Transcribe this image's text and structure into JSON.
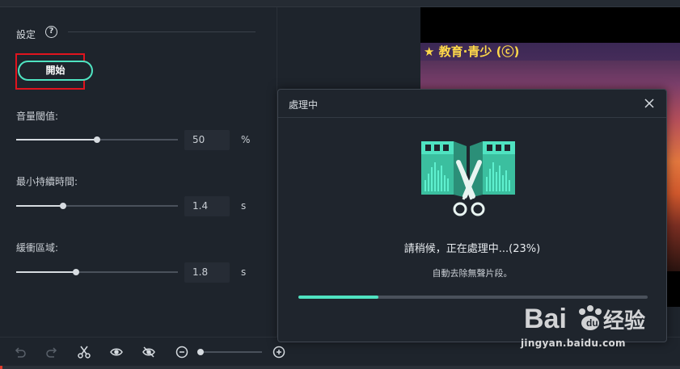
{
  "settings": {
    "title": "設定",
    "help_glyph": "?",
    "start_label": "開始"
  },
  "fields": [
    {
      "label": "音量閾值:",
      "value": "50",
      "unit": "%",
      "fraction": 0.5
    },
    {
      "label": "最小持續時間:",
      "value": "1.4",
      "unit": "s",
      "fraction": 0.29
    },
    {
      "label": "緩衝區域:",
      "value": "1.8",
      "unit": "s",
      "fraction": 0.37
    }
  ],
  "preview": {
    "caption": "★ 教育·青少 (ⓒ)"
  },
  "dialog": {
    "title": "處理中",
    "status": "請稍候，正在處理中...(23%)",
    "subtitle": "自動去除無聲片段。",
    "progress": 0.23
  },
  "toolbar": {
    "zoom_level": 0.05,
    "icons": [
      "undo-icon",
      "redo-icon",
      "scissors-icon",
      "eye-icon",
      "eye-off-icon",
      "zoom-out-icon",
      "zoom-in-icon"
    ]
  },
  "colors": {
    "accent": "#4fe3c1",
    "highlight": "#e0141e",
    "background": "#1e242c"
  },
  "watermark": {
    "text": "jingyan.baidu.com"
  }
}
